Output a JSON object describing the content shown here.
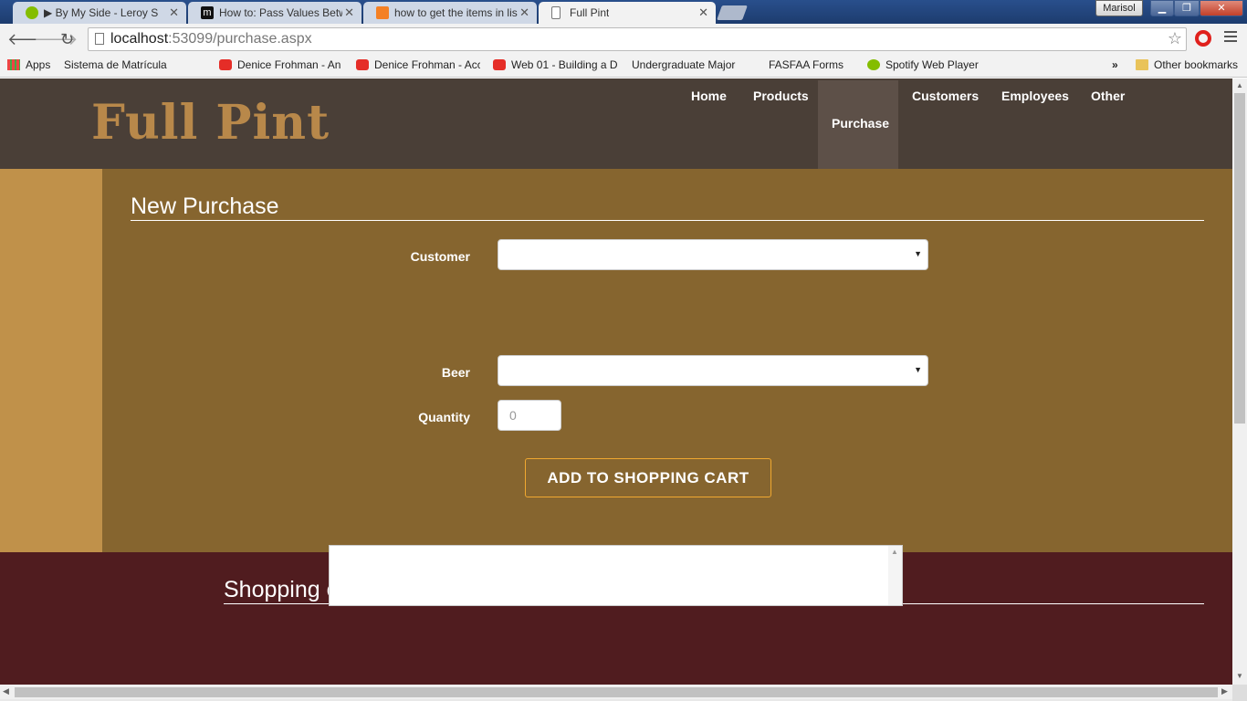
{
  "browser": {
    "tabs": [
      {
        "label": "▶ By My Side - Leroy S",
        "icon": "spotify-icon",
        "color": "#84bd00"
      },
      {
        "label": "How to: Pass Values Betwe",
        "icon": "m-icon",
        "color": "#111111"
      },
      {
        "label": "how to get the items in lis",
        "icon": "stackoverflow-icon",
        "color": "#f48024"
      },
      {
        "label": "Full Pint",
        "icon": "page-icon",
        "color": "#ffffff"
      }
    ],
    "user": "Marisol",
    "url_host": "localhost",
    "url_path": ":53099/purchase.aspx",
    "bookmarks": [
      {
        "label": "Apps",
        "icon": "apps"
      },
      {
        "label": "Sistema de Matrícula",
        "icon": "page"
      },
      {
        "label": "",
        "icon": "page"
      },
      {
        "label": "Denice Frohman - An",
        "icon": "yt"
      },
      {
        "label": "Denice Frohman - Acc",
        "icon": "yt"
      },
      {
        "label": "Web 01 - Building a D",
        "icon": "yt"
      },
      {
        "label": "Undergraduate Major",
        "icon": "page"
      },
      {
        "label": "FASFAA Forms",
        "icon": "page"
      },
      {
        "label": "Spotify Web Player",
        "icon": "spot"
      }
    ],
    "bookmarks_more": "»",
    "other_bookmarks": "Other bookmarks"
  },
  "site": {
    "logo": "Full Pint",
    "nav": [
      "Home",
      "Products",
      "Purchase",
      "Customers",
      "Employees",
      "Other"
    ],
    "active_nav": "Purchase"
  },
  "purchase": {
    "title": "New Purchase",
    "customer_label": "Customer",
    "customer_value": "",
    "beer_label": "Beer",
    "beer_value": "",
    "quantity_label": "Quantity",
    "quantity_value": "0",
    "add_button": "ADD TO SHOPPING CART"
  },
  "cart": {
    "title": "Shopping cart"
  },
  "colors": {
    "header": "#4a3f37",
    "main": "#86652f",
    "sidebar": "#c0914a",
    "cart": "#501c1f",
    "logo": "#b8884a",
    "button_border": "#f0a830"
  }
}
